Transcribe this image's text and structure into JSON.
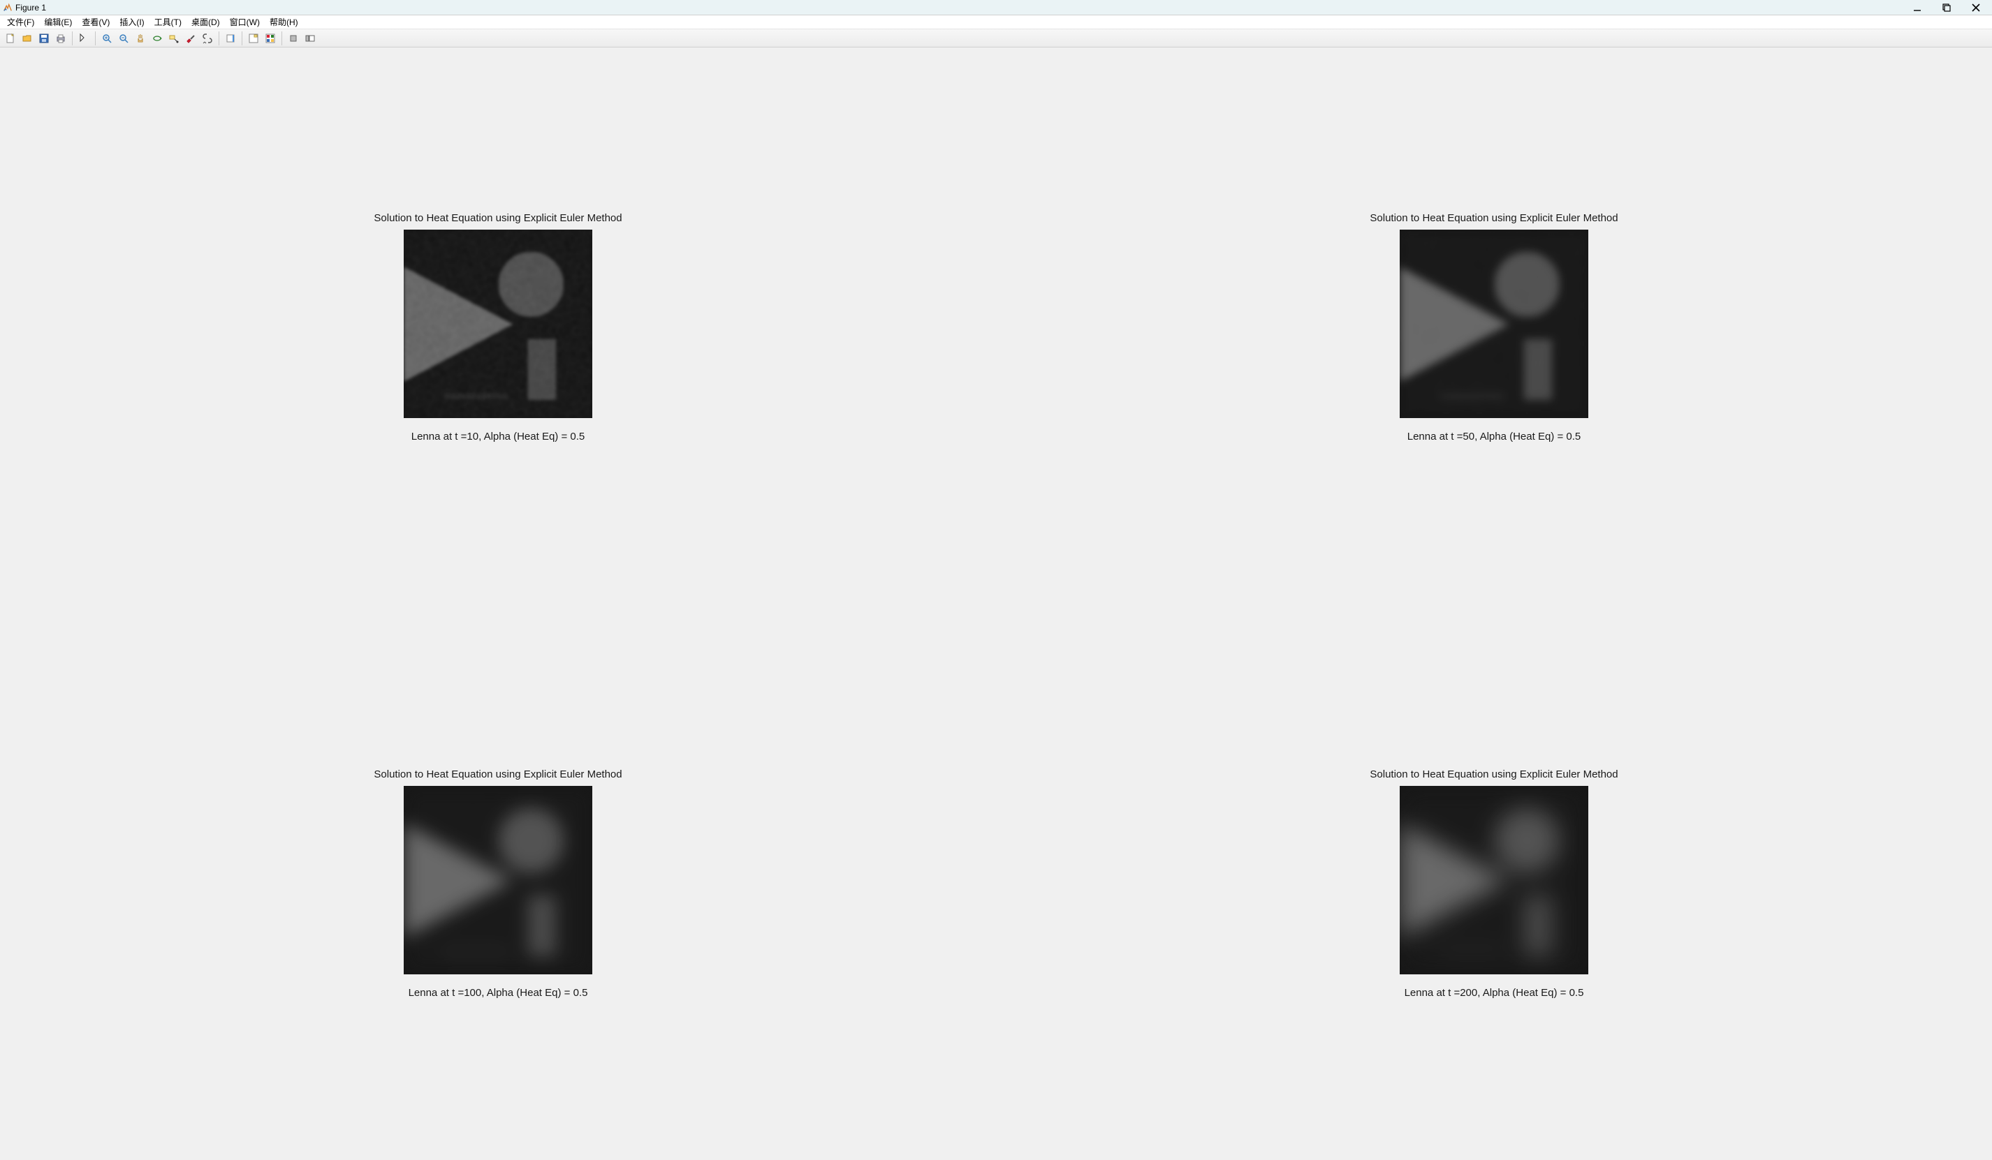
{
  "window": {
    "title": "Figure 1"
  },
  "menubar": {
    "items": [
      "文件(F)",
      "编辑(E)",
      "查看(V)",
      "插入(I)",
      "工具(T)",
      "桌面(D)",
      "窗口(W)",
      "帮助(H)"
    ]
  },
  "toolbar": {
    "icons": [
      "new-icon",
      "open-icon",
      "save-icon",
      "print-icon",
      "sep",
      "pointer-icon",
      "sep",
      "zoom-in-icon",
      "zoom-out-icon",
      "pan-icon",
      "rotate-icon",
      "data-cursor-icon",
      "brush-icon",
      "link-icon",
      "sep",
      "colorbar-icon",
      "sep",
      "insert-legend-icon",
      "insert-colorbar-icon",
      "sep",
      "hide-legend-icon",
      "dock-icon"
    ]
  },
  "subplots": [
    {
      "title": "Solution to Heat Equation using Explicit Euler Method",
      "xlabel": "Lenna at t =10, Alpha (Heat Eq) = 0.5",
      "blur": 2,
      "noise": 18
    },
    {
      "title": "Solution to Heat Equation using Explicit Euler Method",
      "xlabel": "Lenna at t =50, Alpha (Heat Eq) = 0.5",
      "blur": 6,
      "noise": 9
    },
    {
      "title": "Solution to Heat Equation using Explicit Euler Method",
      "xlabel": "Lenna at t =100, Alpha (Heat Eq) = 0.5",
      "blur": 12,
      "noise": 4
    },
    {
      "title": "Solution to Heat Equation using Explicit Euler Method",
      "xlabel": "Lenna at t =200, Alpha (Heat Eq) = 0.5",
      "blur": 16,
      "noise": 2
    }
  ],
  "chart_data": {
    "type": "image",
    "description": "Four subplots showing a grayscale synthetic image (triangle at left, circle upper-right, rectangle lower-right) progressively blurred by the heat equation (diffusion) at time steps t=10,50,100,200 with diffusion coefficient alpha=0.5. Noise decreases and blur increases with t.",
    "alpha": 0.5,
    "time_steps": [
      10,
      50,
      100,
      200
    ],
    "shapes": [
      {
        "shape": "triangle",
        "position": "left",
        "intensity": 120
      },
      {
        "shape": "circle",
        "position": "upper-right",
        "intensity": 100
      },
      {
        "shape": "rectangle",
        "position": "lower-right",
        "intensity": 90
      }
    ],
    "background_intensity": 35,
    "colormap": "gray"
  }
}
